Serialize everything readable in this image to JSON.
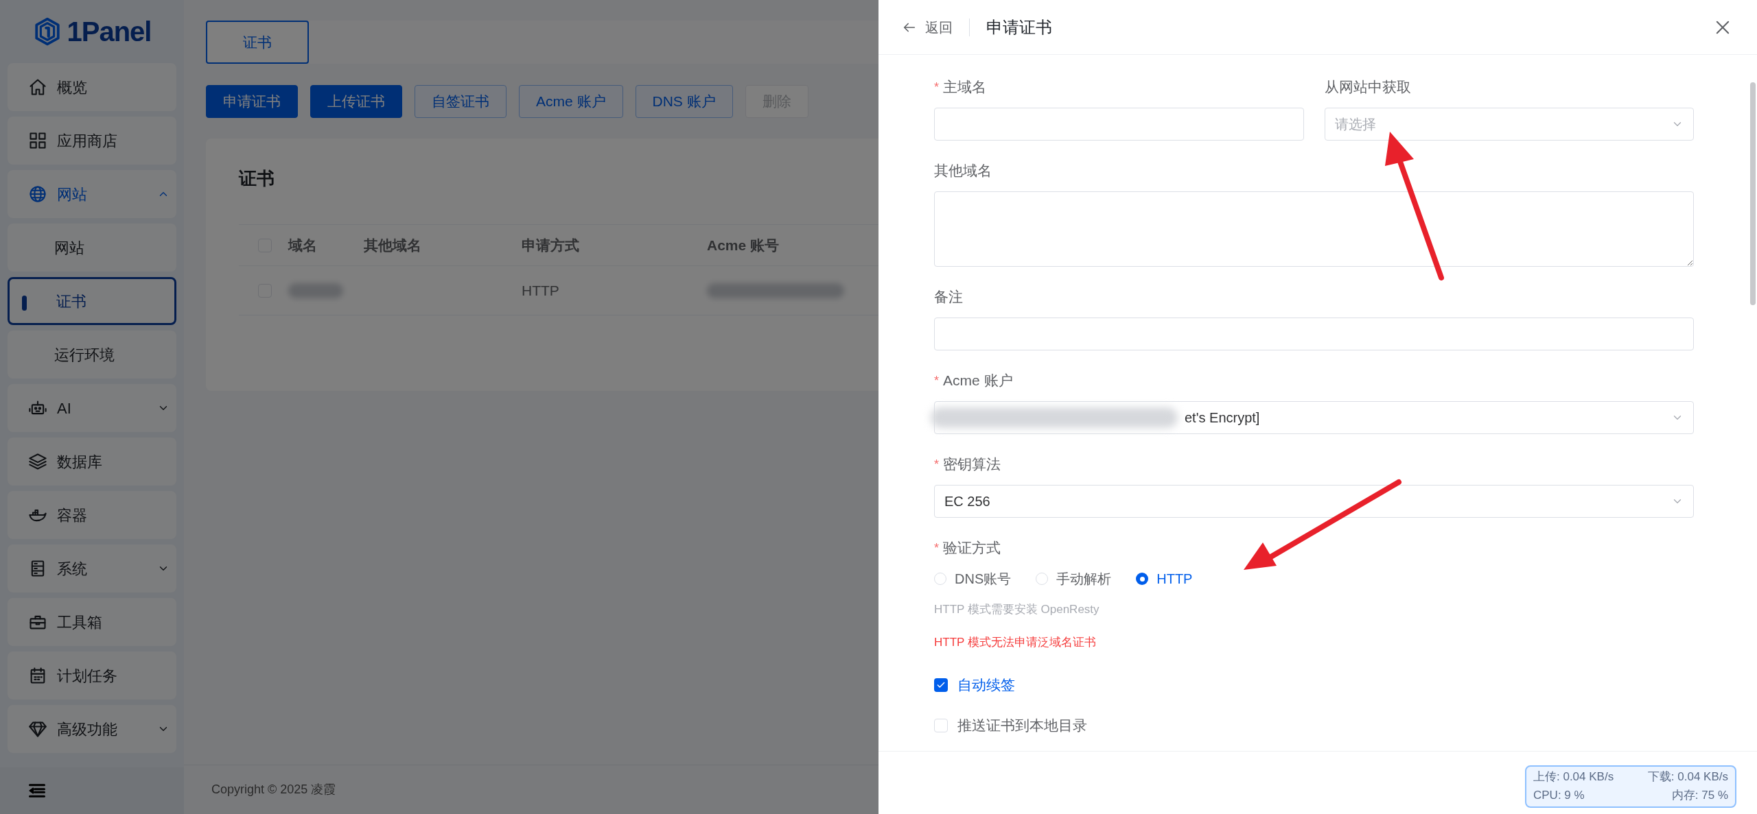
{
  "sidebar": {
    "logo": "1Panel",
    "items": [
      {
        "label": "概览",
        "selected": false
      },
      {
        "label": "应用商店",
        "selected": false
      },
      {
        "label": "网站",
        "selected": false,
        "expanded": true,
        "children": [
          {
            "label": "网站",
            "selected": false
          },
          {
            "label": "证书",
            "selected": true
          },
          {
            "label": "运行环境",
            "selected": false
          }
        ]
      },
      {
        "label": "AI",
        "selected": false,
        "expanded": false
      },
      {
        "label": "数据库",
        "selected": false
      },
      {
        "label": "容器",
        "selected": false
      },
      {
        "label": "系统",
        "selected": false,
        "expanded": false
      },
      {
        "label": "工具箱",
        "selected": false
      },
      {
        "label": "计划任务",
        "selected": false
      },
      {
        "label": "高级功能",
        "selected": false,
        "expanded": false
      }
    ]
  },
  "tabs": [
    {
      "label": "证书",
      "selected": true
    }
  ],
  "toolbar": [
    {
      "label": "申请证书",
      "kind": "primary",
      "disabled": false
    },
    {
      "label": "上传证书",
      "kind": "primary",
      "disabled": false
    },
    {
      "label": "自签证书",
      "kind": "plain",
      "disabled": false
    },
    {
      "label": "Acme 账户",
      "kind": "plain",
      "disabled": false
    },
    {
      "label": "DNS 账户",
      "kind": "plain",
      "disabled": false
    },
    {
      "label": "删除",
      "disabled": true
    }
  ],
  "card": {
    "title": "证书",
    "table": {
      "all_checked": false,
      "columns": [
        "域名",
        "其他域名",
        "申请方式",
        "Acme 账号"
      ],
      "rows": [
        {
          "checked": false,
          "cells": [
            {
              "kind": "redacted"
            },
            {
              "kind": "empty"
            },
            {
              "kind": "text",
              "text": "HTTP"
            },
            {
              "kind": "redacted"
            }
          ]
        }
      ]
    }
  },
  "footer": "Copyright © 2025 凌霞",
  "drawer": {
    "back": "返回",
    "title": "申请证书",
    "rows": [
      {
        "fields": [
          {
            "kind": "input",
            "label": "主域名",
            "marker": "*"
          },
          {
            "kind": "select",
            "label": "从网站中获取",
            "placeholder": "请选择"
          }
        ]
      },
      {
        "fields": [
          {
            "kind": "textarea",
            "label": "其他域名"
          }
        ]
      },
      {
        "fields": [
          {
            "kind": "input",
            "label": "备注"
          }
        ]
      },
      {
        "fields": [
          {
            "kind": "select",
            "label": "Acme 账户",
            "marker": "*",
            "value": "et's Encrypt]",
            "redacted": true
          }
        ]
      },
      {
        "fields": [
          {
            "kind": "select",
            "label": "密钥算法",
            "marker": "*",
            "value": "EC 256"
          }
        ]
      },
      {
        "fields": [
          {
            "kind": "radio",
            "label": "验证方式",
            "marker": "*",
            "options": [
              {
                "label": "DNS账号",
                "selected": false
              },
              {
                "label": "手动解析",
                "selected": false
              },
              {
                "label": "HTTP",
                "selected": true
              }
            ]
          }
        ]
      },
      {
        "fields": [
          {
            "kind": "hint",
            "text": "HTTP 模式需要安装 OpenResty"
          }
        ]
      },
      {
        "fields": [
          {
            "kind": "error",
            "text": "HTTP 模式无法申请泛域名证书"
          }
        ]
      },
      {
        "fields": [
          {
            "kind": "checkbox",
            "label": "自动续签",
            "checked": true
          }
        ]
      },
      {
        "fields": [
          {
            "kind": "checkbox",
            "label": "推送证书到本地目录",
            "checked": false
          }
        ]
      }
    ]
  },
  "monitor": {
    "upload": "上传: 0.04 KB/s",
    "download": "下载: 0.04 KB/s",
    "cpu": "CPU: 9 %",
    "memory": "内存: 75 %"
  }
}
